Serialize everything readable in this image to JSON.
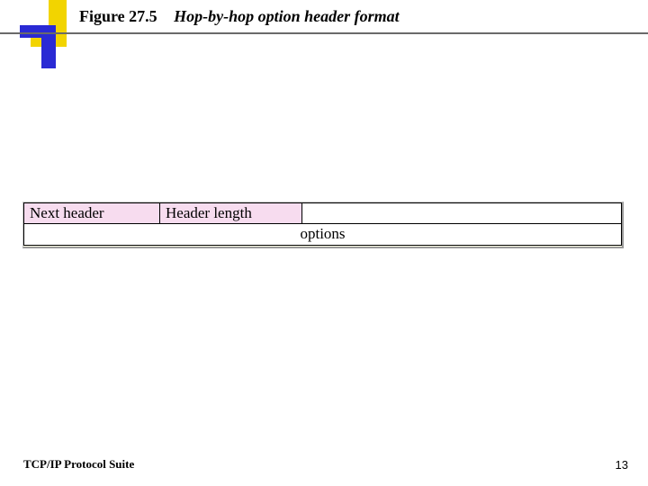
{
  "title": {
    "figure_label": "Figure 27.5",
    "caption": "Hop-by-hop option header format"
  },
  "diagram": {
    "cell_next_header": "Next header",
    "cell_header_length": "Header length",
    "cell_options": "options"
  },
  "footer": {
    "suite": "TCP/IP Protocol Suite",
    "page": "13"
  }
}
